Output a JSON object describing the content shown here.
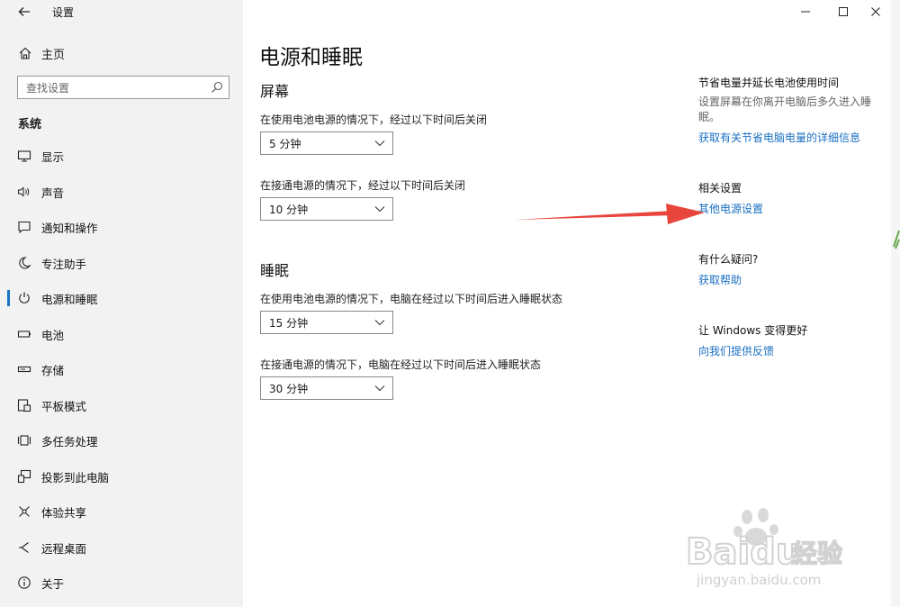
{
  "window": {
    "title": "设置"
  },
  "sidebar": {
    "home_label": "主页",
    "search_placeholder": "查找设置",
    "section_label": "系统",
    "items": [
      {
        "label": "显示",
        "icon": "monitor-icon"
      },
      {
        "label": "声音",
        "icon": "speaker-icon"
      },
      {
        "label": "通知和操作",
        "icon": "notification-icon"
      },
      {
        "label": "专注助手",
        "icon": "moon-icon"
      },
      {
        "label": "电源和睡眠",
        "icon": "power-icon",
        "active": true
      },
      {
        "label": "电池",
        "icon": "battery-icon"
      },
      {
        "label": "存储",
        "icon": "storage-icon"
      },
      {
        "label": "平板模式",
        "icon": "tablet-icon"
      },
      {
        "label": "多任务处理",
        "icon": "multitask-icon"
      },
      {
        "label": "投影到此电脑",
        "icon": "projection-icon"
      },
      {
        "label": "体验共享",
        "icon": "share-icon"
      },
      {
        "label": "远程桌面",
        "icon": "remote-icon"
      },
      {
        "label": "关于",
        "icon": "info-icon"
      }
    ]
  },
  "main": {
    "page_title": "电源和睡眠",
    "screen": {
      "title": "屏幕",
      "battery_label": "在使用电池电源的情况下，经过以下时间后关闭",
      "battery_value": "5 分钟",
      "plugged_label": "在接通电源的情况下，经过以下时间后关闭",
      "plugged_value": "10 分钟"
    },
    "sleep": {
      "title": "睡眠",
      "battery_label": "在使用电池电源的情况下，电脑在经过以下时间后进入睡眠状态",
      "battery_value": "15 分钟",
      "plugged_label": "在接通电源的情况下，电脑在经过以下时间后进入睡眠状态",
      "plugged_value": "30 分钟"
    }
  },
  "right_panel": {
    "save_heading": "节省电量并延长电池使用时间",
    "save_text": "设置屏幕在你离开电脑后多久进入睡眠。",
    "save_link": "获取有关节省电脑电量的详细信息",
    "related_heading": "相关设置",
    "related_link": "其他电源设置",
    "question_heading": "有什么疑问?",
    "help_link": "获取帮助",
    "improve_heading": "让 Windows 变得更好",
    "feedback_link": "向我们提供反馈"
  },
  "watermark": {
    "brand": "Bai",
    "brand2": "du",
    "jingyan": "经验",
    "url": "jingyan.baidu.com"
  },
  "colors": {
    "accent": "#1a73c8",
    "link": "#1a6fc2",
    "arrow": "#e8453c",
    "sidebar_bg": "#f2f2f2"
  }
}
